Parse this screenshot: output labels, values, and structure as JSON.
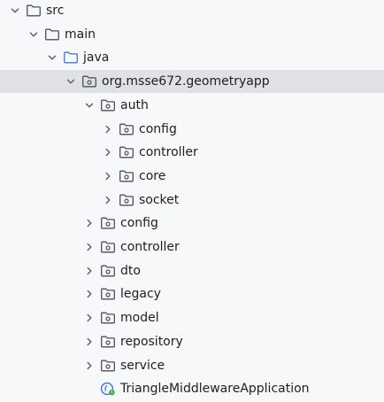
{
  "tree": {
    "items": [
      {
        "label": "src",
        "depth": 0,
        "expanded": true,
        "icon": "folder-icon",
        "selected": false
      },
      {
        "label": "main",
        "depth": 1,
        "expanded": true,
        "icon": "folder-icon",
        "selected": false
      },
      {
        "label": "java",
        "depth": 2,
        "expanded": true,
        "icon": "source-folder-icon",
        "selected": false
      },
      {
        "label": "org.msse672.geometryapp",
        "depth": 3,
        "expanded": true,
        "icon": "package-icon",
        "selected": true
      },
      {
        "label": "auth",
        "depth": 4,
        "expanded": true,
        "icon": "package-icon",
        "selected": false
      },
      {
        "label": "config",
        "depth": 5,
        "expanded": false,
        "icon": "package-icon",
        "selected": false
      },
      {
        "label": "controller",
        "depth": 5,
        "expanded": false,
        "icon": "package-icon",
        "selected": false
      },
      {
        "label": "core",
        "depth": 5,
        "expanded": false,
        "icon": "package-icon",
        "selected": false
      },
      {
        "label": "socket",
        "depth": 5,
        "expanded": false,
        "icon": "package-icon",
        "selected": false
      },
      {
        "label": "config",
        "depth": 4,
        "expanded": false,
        "icon": "package-icon",
        "selected": false
      },
      {
        "label": "controller",
        "depth": 4,
        "expanded": false,
        "icon": "package-icon",
        "selected": false
      },
      {
        "label": "dto",
        "depth": 4,
        "expanded": false,
        "icon": "package-icon",
        "selected": false
      },
      {
        "label": "legacy",
        "depth": 4,
        "expanded": false,
        "icon": "package-icon",
        "selected": false
      },
      {
        "label": "model",
        "depth": 4,
        "expanded": false,
        "icon": "package-icon",
        "selected": false
      },
      {
        "label": "repository",
        "depth": 4,
        "expanded": false,
        "icon": "package-icon",
        "selected": false
      },
      {
        "label": "service",
        "depth": 4,
        "expanded": false,
        "icon": "package-icon",
        "selected": false
      },
      {
        "label": "TriangleMiddlewareApplication",
        "depth": 4,
        "expanded": null,
        "icon": "spring-boot-class-icon",
        "selected": false
      }
    ]
  },
  "colors": {
    "background": "#f7f8fa",
    "selection": "#dfe1e5",
    "source_folder": "#4a73d6",
    "folder_stroke": "#4c4f56",
    "spring_green": "#4ea94b",
    "class_blue": "#3574f0"
  }
}
